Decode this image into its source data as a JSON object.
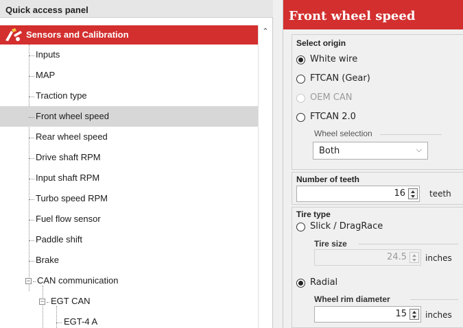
{
  "left_panel": {
    "header": "Quick access panel",
    "category": "Sensors and Calibration",
    "items": [
      {
        "label": "Inputs"
      },
      {
        "label": "MAP"
      },
      {
        "label": "Traction type"
      },
      {
        "label": "Front wheel speed",
        "selected": true
      },
      {
        "label": "Rear wheel speed"
      },
      {
        "label": "Drive shaft RPM"
      },
      {
        "label": "Input shaft RPM"
      },
      {
        "label": "Turbo speed RPM"
      },
      {
        "label": "Fuel flow sensor"
      },
      {
        "label": "Paddle shift"
      },
      {
        "label": "Brake"
      },
      {
        "label": "CAN communication"
      },
      {
        "label": "EGT CAN"
      },
      {
        "label": "EGT-4 A"
      }
    ]
  },
  "right_panel": {
    "title": "Front wheel speed",
    "select_origin": {
      "title": "Select origin",
      "options": [
        {
          "label": "White wire",
          "checked": true
        },
        {
          "label": "FTCAN (Gear)"
        },
        {
          "label": "OEM CAN",
          "disabled": true
        },
        {
          "label": "FTCAN 2.0"
        }
      ],
      "wheel_selection_label": "Wheel selection",
      "wheel_selection_value": "Both"
    },
    "number_of_teeth": {
      "title": "Number of teeth",
      "value": "16",
      "unit": "teeth"
    },
    "tire_type": {
      "title": "Tire type",
      "option_slick": "Slick / DragRace",
      "tire_size_label": "Tire size",
      "tire_size_value": "24.5",
      "tire_size_unit": "inches",
      "option_radial": "Radial",
      "rim_label": "Wheel rim diameter",
      "rim_value": "15",
      "rim_unit": "inches"
    }
  },
  "colors": {
    "accent_red": "#d32f2f",
    "selected_row": "#d7d7d7"
  }
}
